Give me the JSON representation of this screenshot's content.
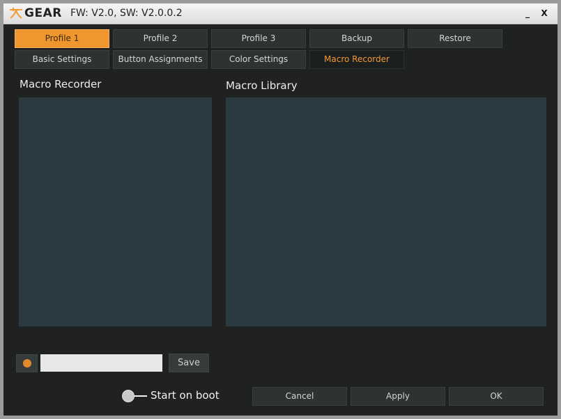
{
  "window": {
    "logo_text": "GEAR",
    "version": "FW: V2.0, SW: V2.0.0.2",
    "minimize_label": "_",
    "close_label": "X"
  },
  "profile_tabs": [
    {
      "label": "Profile 1",
      "active": true
    },
    {
      "label": "Profile 2",
      "active": false
    },
    {
      "label": "Profile 3",
      "active": false
    },
    {
      "label": "Backup",
      "active": false
    },
    {
      "label": "Restore",
      "active": false
    }
  ],
  "settings_tabs": [
    {
      "label": "Basic Settings",
      "active": false
    },
    {
      "label": "Button Assignments",
      "active": false
    },
    {
      "label": "Color Settings",
      "active": false
    },
    {
      "label": "Macro Recorder",
      "active": true
    }
  ],
  "macro_recorder": {
    "title": "Macro Recorder"
  },
  "macro_library": {
    "title": "Macro Library"
  },
  "record": {
    "name_value": "",
    "save_label": "Save"
  },
  "boot": {
    "label": "Start on boot",
    "enabled": false
  },
  "actions": {
    "cancel_label": "Cancel",
    "apply_label": "Apply",
    "ok_label": "OK"
  },
  "colors": {
    "accent": "#f0962e",
    "panel": "#2b3a40",
    "background": "#202121"
  }
}
